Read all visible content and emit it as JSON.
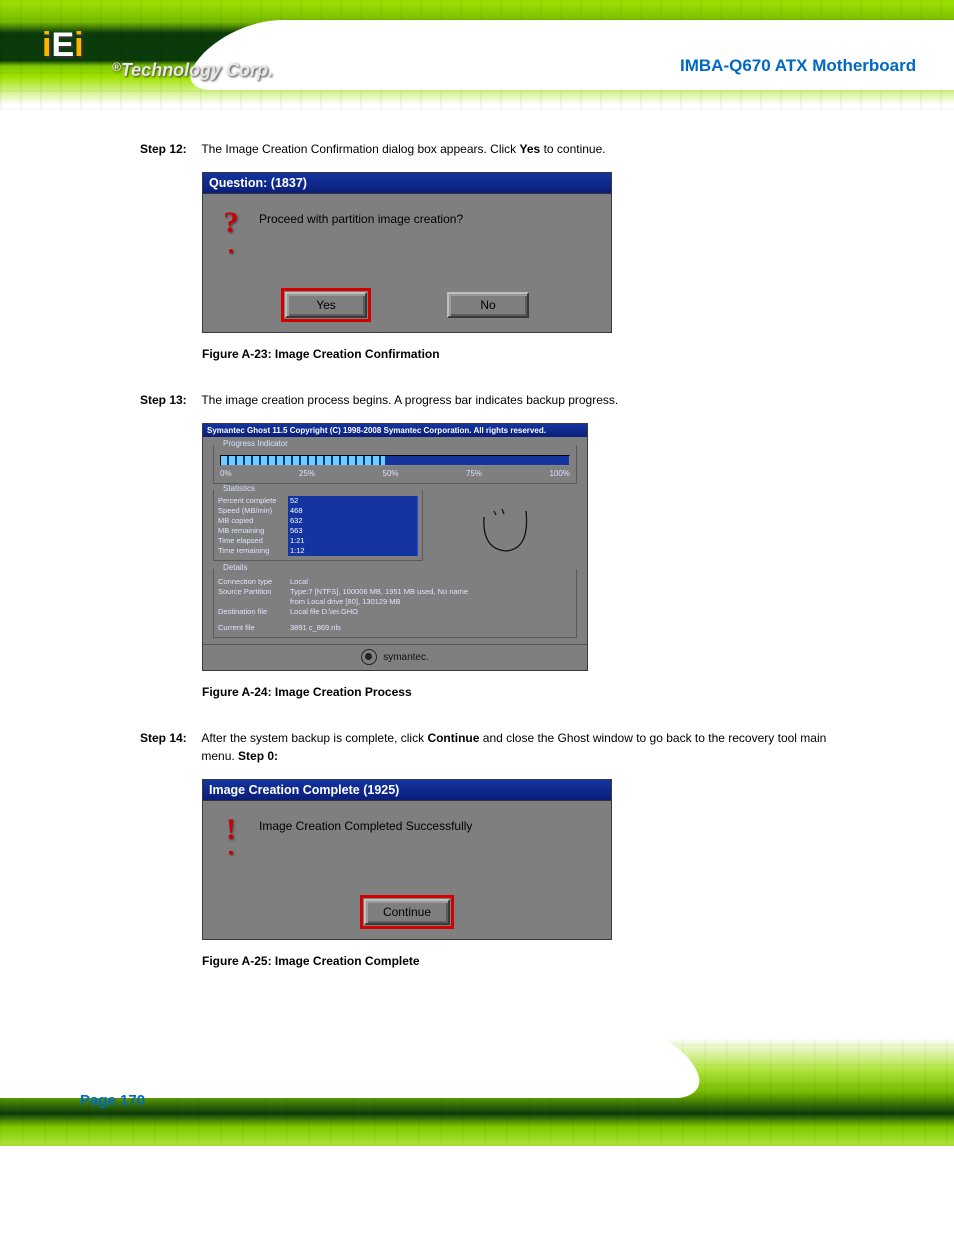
{
  "header": {
    "page_title": "IMBA-Q670 ATX Motherboard"
  },
  "logo": {
    "text_i1": "i",
    "text_E": "E",
    "text_i2": "i",
    "tagline_r": "®",
    "tagline": "Technology Corp."
  },
  "steps": {
    "s12": {
      "label": "Step 12:",
      "text_pre": "The Image Creation Confirmation dialog box appears. Click ",
      "bold": "Yes",
      "text_post": " to continue."
    },
    "s13": {
      "label": "Step 13:",
      "text": "The image creation process begins. A progress bar indicates backup progress."
    },
    "s14": {
      "label": "Step 14:",
      "text_pre": "After the system backup is complete, click ",
      "bold": "Continue",
      "text_mid": " and close the Ghost window to go back to the recovery tool main menu. ",
      "bold2": "Step 0:"
    }
  },
  "dlg_question": {
    "title": "Question: (1837)",
    "message": "Proceed with partition image creation?",
    "btn_yes": "Yes",
    "btn_no": "No"
  },
  "fig23": "Figure A-23: Image Creation Confirmation",
  "ghost": {
    "title": "Symantec Ghost 11.5    Copyright (C) 1998-2008 Symantec Corporation. All rights reserved.",
    "legend_progress": "Progress Indicator",
    "ticks": {
      "t0": "0%",
      "t25": "25%",
      "t50": "50%",
      "t75": "75%",
      "t100": "100%"
    },
    "legend_stats": "Statistics",
    "stats": {
      "pc_k": "Percent complete",
      "pc_v": "52",
      "sp_k": "Speed (MB/min)",
      "sp_v": "468",
      "mc_k": "MB copied",
      "mc_v": "632",
      "mr_k": "MB remaining",
      "mr_v": "563",
      "te_k": "Time elapsed",
      "te_v": "1:21",
      "tr_k": "Time remaining",
      "tr_v": "1:12"
    },
    "legend_details": "Details",
    "details": {
      "ct_k": "Connection type",
      "ct_v": "Local",
      "sp_k": "Source Partition",
      "sp_v1": "Type:7 [NTFS], 100006 MB, 1951 MB used, No name",
      "sp_v2": "from Local drive [80], 130129 MB",
      "df_k": "Destination file",
      "df_v": "Local file D:\\iei.GHO",
      "cf_k": "Current file",
      "cf_v": "3891 c_869.nls"
    },
    "brand": "symantec."
  },
  "fig24": "Figure A-24: Image Creation Process",
  "dlg_complete": {
    "title": "Image Creation Complete (1925)",
    "message": "Image Creation Completed Successfully",
    "btn_continue": "Continue"
  },
  "fig25": "Figure A-25: Image Creation Complete",
  "footer": {
    "page": "Page 170"
  }
}
